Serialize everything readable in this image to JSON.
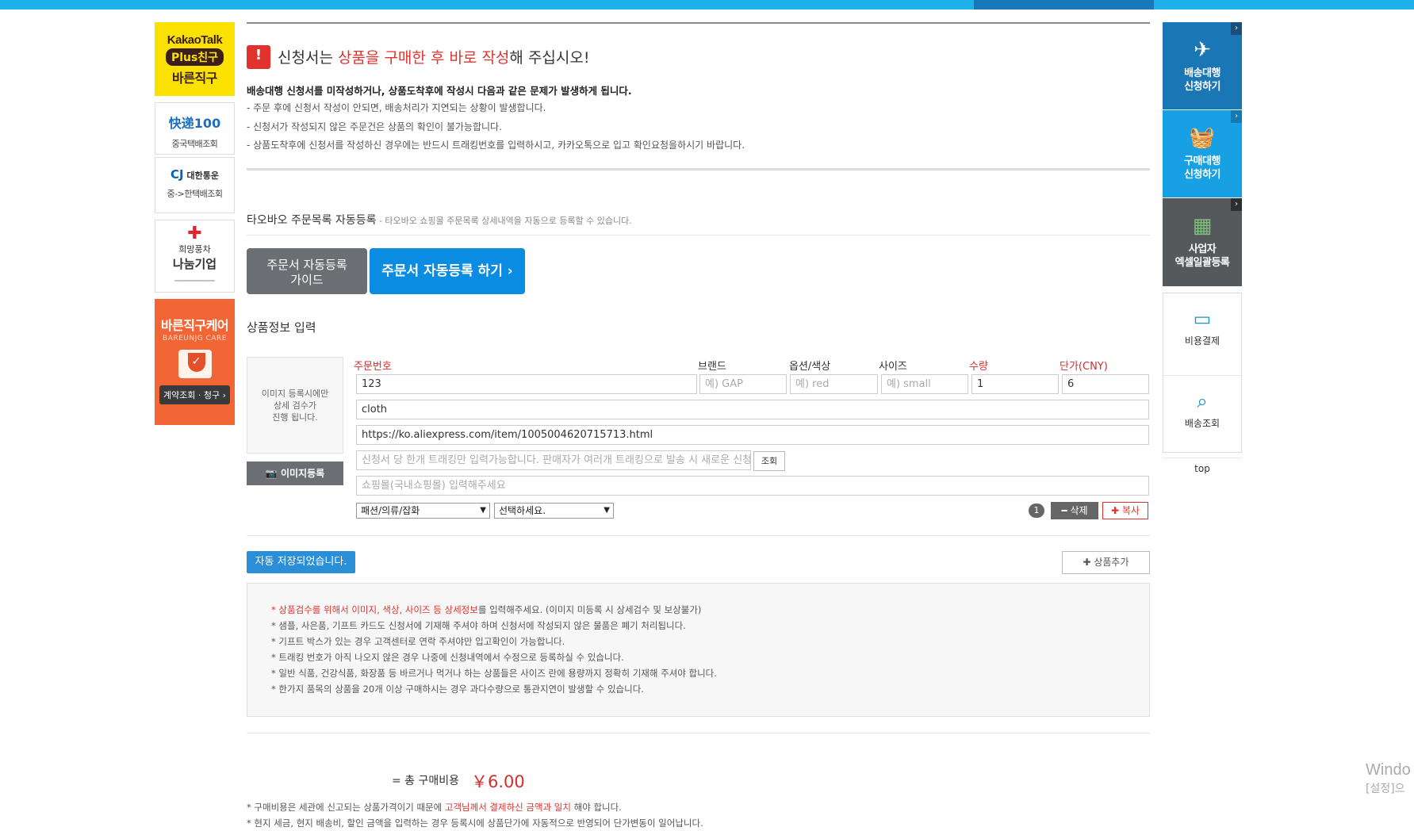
{
  "left": {
    "kakao": {
      "line1": "KakaoTalk",
      "line2": "Plus친구",
      "line3": "바른직구"
    },
    "kuaidi": {
      "logo": "快递100",
      "label": "중국택배조회"
    },
    "cj": {
      "logo_cj": "CJ",
      "logo_name": "대한통운",
      "label": "중->한택배조회"
    },
    "hope": {
      "line1": "희망풍차",
      "line2": "나눔기업"
    },
    "care": {
      "title": "바른직구케어",
      "sub": "BAREUNJG CARE",
      "button": "계약조회 · 청구 ›"
    }
  },
  "warning": {
    "title_pre": "신청서는 ",
    "title_red": "상품을 구매한 후 바로 작성",
    "title_post": "해 주십시오!",
    "bold": "배송대행 신청서를 미작성하거나, 상품도착후에 작성시 다음과 같은 문제가 발생하게 됩니다.",
    "lines": [
      "- 주문 후에 신청서 작성이 안되면, 배송처리가 지연되는 상황이 발생합니다.",
      "- 신청서가 작성되지 않은 주문건은 상품의 확인이 불가능합니다.",
      "- 상품도착후에 신청서를 작성하신 경우에는 반드시 트래킹번호를 입력하시고, 카카오톡으로 입고 확인요청을하시기 바랍니다."
    ]
  },
  "taobao": {
    "title": "타오바오 주문목록 자동등록",
    "desc": " - 타오바오 쇼핑몰 주문목록 상세내역을 자동으로 등록할 수 있습니다.",
    "guide_btn_1": "주문서 자동등록",
    "guide_btn_2": "가이드",
    "auto_btn": "주문서 자동등록 하기 ›"
  },
  "product": {
    "title": "상품정보 입력",
    "img_hint_1": "이미지 등록시에만",
    "img_hint_2": "상세 검수가",
    "img_hint_3": "진행 됩니다.",
    "img_btn": "이미지등록",
    "headers": {
      "order": "주문번호",
      "brand": "브랜드",
      "option": "옵션/색상",
      "size": "사이즈",
      "qty": "수량",
      "price": "단가(CNY)"
    },
    "values": {
      "order": "123",
      "qty": "1",
      "price": "6",
      "name": "cloth",
      "url": "https://ko.aliexpress.com/item/1005004620715713.html"
    },
    "placeholders": {
      "brand": "예) GAP",
      "option": "예) red",
      "size": "예) small",
      "tracking": "신청서 당 한개 트래킹만 입력가능합니다. 판매자가 여러개 트래킹으로 발송 시 새로운 신청",
      "domestic": "쇼핑몰(국내쇼핑몰) 입력해주세요"
    },
    "search_btn": "조회",
    "category": "패션/의류/잡화",
    "subcategory": "선택하세요.",
    "index": "1",
    "delete_btn": "━ 삭제",
    "copy_btn": "✚ 복사"
  },
  "saved_btn": "자동 저장되었습니다.",
  "add_btn": "✚ 상품추가",
  "guide": {
    "line1_red": "* 상품검수를 위해서 이미지, 색상, 사이즈 등 상세정보",
    "line1_rest": "를 입력해주세요. (이미지 미등록 시 상세검수 및 보상불가)",
    "lines": [
      "* 샘플, 사은품, 기프트 카드도 신청서에 기재해 주셔야 하며 신청서에 작성되지 않은 물품은 폐기 처리됩니다.",
      "* 기프트 박스가 있는 경우 고객센터로 연락 주셔야만 입고확인이 가능합니다.",
      "* 트래킹 번호가 아직 나오지 않은 경우 나중에 신청내역에서 수정으로 등록하실 수 있습니다.",
      "* 일반 식품, 건강식품, 화장품 등 바르거나 먹거나 하는 상품들은 사이즈 란에 용량까지 정확히 기재해 주셔야 합니다.",
      "* 한가지 품목의 상품을 20개 이상 구매하시는 경우 과다수량으로 통관지연이 발생할 수 있습니다."
    ]
  },
  "total": {
    "label": "= 총 구매비용",
    "value": "￥6.00"
  },
  "footer": {
    "l1_pre": "* 구매비용은 세관에 신고되는 상품가격이기 때문에 ",
    "l1_red": "고객님께서 결제하신 금액과 일치",
    "l1_post": " 해야 합니다.",
    "l2": "* 현지 세금, 현지 배송비, 할인 금액을 입력하는 경우 등록시에 상품단가에 자동적으로 반영되어 단가변동이 일어납니다."
  },
  "right": {
    "ship_1": "배송대행",
    "ship_2": "신청하기",
    "buy_1": "구매대행",
    "buy_2": "신청하기",
    "excel_1": "사업자",
    "excel_2": "엑셀일괄등록",
    "pay": "비용결제",
    "track": "배송조회",
    "top": "top"
  },
  "os": {
    "win1": "Windo",
    "win2": "[설정]으"
  }
}
